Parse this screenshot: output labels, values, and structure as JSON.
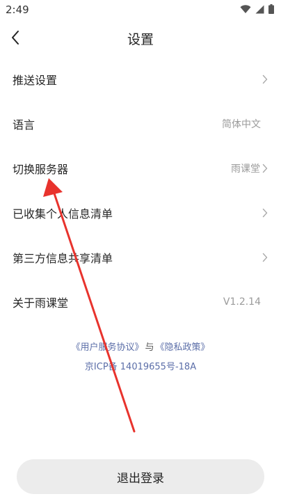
{
  "status_bar": {
    "time": "2:49",
    "icons": [
      "wifi-icon",
      "signal-icon",
      "battery-icon"
    ]
  },
  "header": {
    "title": "设置"
  },
  "settings": {
    "items": [
      {
        "label": "推送设置",
        "value": "",
        "chevron": true
      },
      {
        "label": "语言",
        "value": "简体中文",
        "chevron": false
      },
      {
        "label": "切换服务器",
        "value": "雨课堂",
        "chevron": true
      },
      {
        "label": "已收集个人信息清单",
        "value": "",
        "chevron": true
      },
      {
        "label": "第三方信息共享清单",
        "value": "",
        "chevron": true
      },
      {
        "label": "关于雨课堂",
        "value": "V1.2.14",
        "chevron": false
      }
    ]
  },
  "footer": {
    "user_agreement": "《用户服务协议》",
    "separator": "与",
    "privacy_policy": "《隐私政策》",
    "icp": "京ICP备 14019655号-18A"
  },
  "logout": {
    "label": "退出登录"
  },
  "colors": {
    "link": "#5b6ea8",
    "annotation_arrow": "#e8332d",
    "button_bg": "#ececec"
  }
}
